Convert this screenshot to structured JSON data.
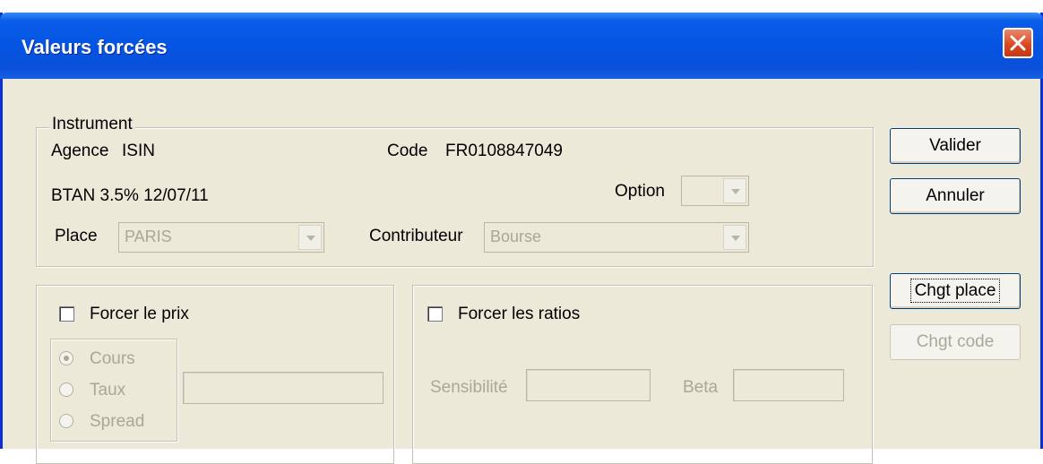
{
  "window": {
    "title": "Valeurs forcées"
  },
  "instrument": {
    "legend": "Instrument",
    "agence_label": "Agence",
    "agence_value": "ISIN",
    "code_label": "Code",
    "code_value": "FR0108847049",
    "description": "BTAN 3.5% 12/07/11",
    "option_label": "Option",
    "option_value": "",
    "place_label": "Place",
    "place_value": "PARIS",
    "contributeur_label": "Contributeur",
    "contributeur_value": "Bourse"
  },
  "buttons": {
    "valider": "Valider",
    "annuler": "Annuler",
    "chgt_place": "Chgt place",
    "chgt_code": "Chgt code"
  },
  "prix": {
    "checkbox_label": "Forcer le prix",
    "checked": false,
    "options": [
      "Cours",
      "Taux",
      "Spread"
    ],
    "selected": "Cours",
    "value": ""
  },
  "ratios": {
    "checkbox_label": "Forcer les ratios",
    "checked": false,
    "sensibilite_label": "Sensibilité",
    "sensibilite_value": "",
    "beta_label": "Beta",
    "beta_value": ""
  },
  "colors": {
    "title_bar": "#0554e3",
    "dialog_bg": "#ece9d8",
    "close_button": "#d9451c",
    "disabled_text": "#a9a796"
  }
}
